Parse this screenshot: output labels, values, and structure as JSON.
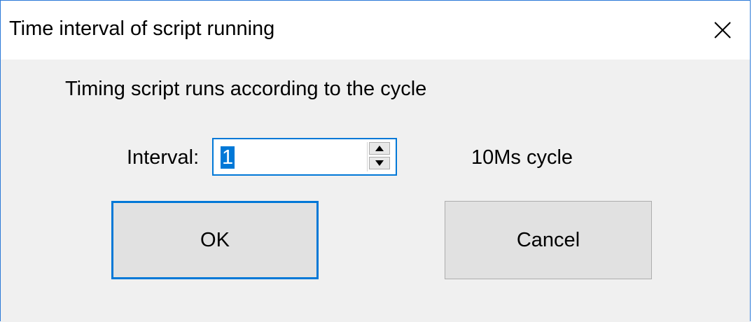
{
  "dialog": {
    "title": "Time interval of script running",
    "close_icon": "close-icon",
    "description": "Timing script runs according to the cycle",
    "interval_label": "Interval:",
    "interval_value": "1",
    "unit_label": "10Ms cycle",
    "ok_label": "OK",
    "cancel_label": "Cancel"
  },
  "colors": {
    "accent": "#0078d7",
    "window_border": "#2b79d8",
    "client_background": "#f0f0f0",
    "button_background": "#e1e1e1"
  }
}
